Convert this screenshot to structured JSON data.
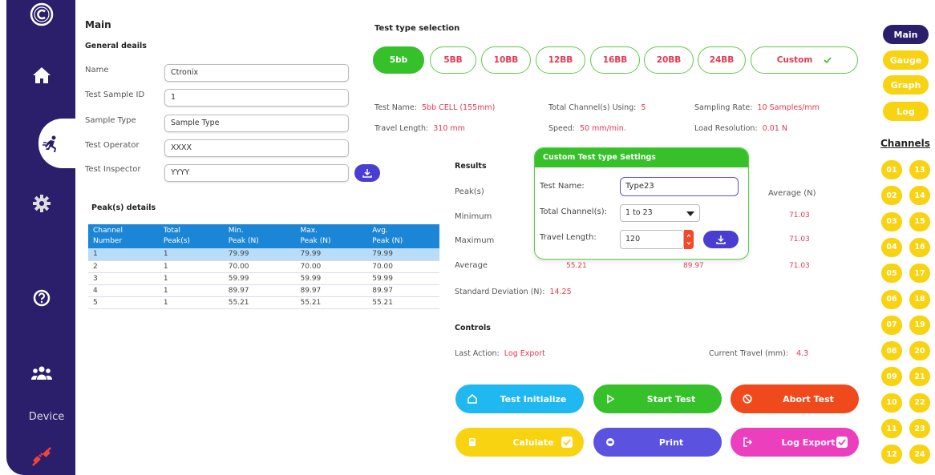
{
  "sidebar": {
    "logo_icon": "copyright-circle-icon",
    "items": [
      {
        "name": "home",
        "icon": "home-icon"
      },
      {
        "name": "test",
        "icon": "running-person-icon",
        "active": true
      },
      {
        "name": "settings",
        "icon": "gear-icon"
      },
      {
        "name": "help",
        "icon": "help-circle-icon"
      },
      {
        "name": "users",
        "icon": "users-icon"
      }
    ],
    "device_label": "Device",
    "device_icon": "disconnected-plug-icon"
  },
  "main": {
    "title": "Main",
    "general_title": "General deails",
    "fields": [
      {
        "label": "Name",
        "value": "Ctronix"
      },
      {
        "label": "Test Sample ID",
        "value": "1"
      },
      {
        "label": "Sample Type",
        "value": "Sample Type"
      },
      {
        "label": "Test Operator",
        "value": "XXXX"
      },
      {
        "label": "Test Inspector",
        "value": "YYYY"
      }
    ]
  },
  "peaks": {
    "title": "Peak(s) details",
    "headers": [
      [
        "Channel",
        "Number"
      ],
      [
        "Total",
        "Peak(s)"
      ],
      [
        "Min.",
        "Peak (N)"
      ],
      [
        "Max.",
        "Peak (N)"
      ],
      [
        "Avg.",
        "Peak (N)"
      ]
    ],
    "rows": [
      [
        "1",
        "1",
        "79.99",
        "79.99",
        "79.99"
      ],
      [
        "2",
        "1",
        "70.00",
        "70.00",
        "70.00"
      ],
      [
        "3",
        "1",
        "59.99",
        "59.99",
        "59.99"
      ],
      [
        "4",
        "1",
        "89.97",
        "89.97",
        "89.97"
      ],
      [
        "5",
        "1",
        "55.21",
        "55.21",
        "55.21"
      ]
    ]
  },
  "test_type": {
    "title": "Test type selection",
    "options": [
      "5bb",
      "5BB",
      "10BB",
      "12BB",
      "16BB",
      "20BB",
      "24BB"
    ],
    "custom_label": "Custom",
    "selected": "5bb"
  },
  "test_info": {
    "test_name_label": "Test Name:",
    "test_name": "5bb CELL (155mm)",
    "channels_label": "Total Channel(s) Using:",
    "channels": "5",
    "sampling_label": "Sampling Rate:",
    "sampling": "10 Samples/mm",
    "travel_label": "Travel Length:",
    "travel": "310 mm",
    "speed_label": "Speed:",
    "speed": "50 mm/min.",
    "load_label": "Load Resolution:",
    "load": "0.01 N"
  },
  "results": {
    "title": "Results",
    "row_labels": [
      "Peak(s)",
      "Minimum",
      "Maximum",
      "Average"
    ],
    "avg_header": "Average (N)",
    "average_col": [
      "71.03",
      "71.03",
      "71.03"
    ],
    "average_row_values": [
      "55.21",
      "89.97"
    ],
    "std_label": "Standard Deviation (N):",
    "std_value": "14.25"
  },
  "custom_popup": {
    "title": "Custom Test type Settings",
    "name_label": "Test Name:",
    "name_value": "Type23",
    "channels_label": "Total Channel(s):",
    "channels_value": "1 to 23",
    "length_label": "Travel Length:",
    "length_value": "120"
  },
  "controls": {
    "title": "Controls",
    "last_action_label": "Last Action:",
    "last_action": "Log Export",
    "current_travel_label": "Current Travel (mm):",
    "current_travel": "4.3",
    "buttons": {
      "initialize": "Test Initialize",
      "start": "Start Test",
      "abort": "Abort Test",
      "calculate": "Calulate",
      "print": "Print",
      "log_export": "Log Export"
    },
    "colors": {
      "initialize": "#1fb8f0",
      "start": "#36c02a",
      "abort": "#f04a1c",
      "calculate": "#f7d311",
      "print": "#5b52e0",
      "log_export": "#ec3fbe"
    }
  },
  "right_nav": {
    "items": [
      "Main",
      "Gauge",
      "Graph",
      "Log"
    ],
    "active": "Main",
    "channels_title": "Channels",
    "channels": [
      "01",
      "13",
      "02",
      "14",
      "03",
      "15",
      "04",
      "16",
      "05",
      "17",
      "06",
      "18",
      "07",
      "19",
      "08",
      "20",
      "09",
      "21",
      "10",
      "22",
      "11",
      "23",
      "12",
      "24"
    ]
  },
  "colors": {
    "sidebar": "#2b1f6b",
    "accent_green": "#36c02a",
    "value_red": "#e53950",
    "table_header": "#1b86d6",
    "channel_yellow": "#f7d311"
  }
}
